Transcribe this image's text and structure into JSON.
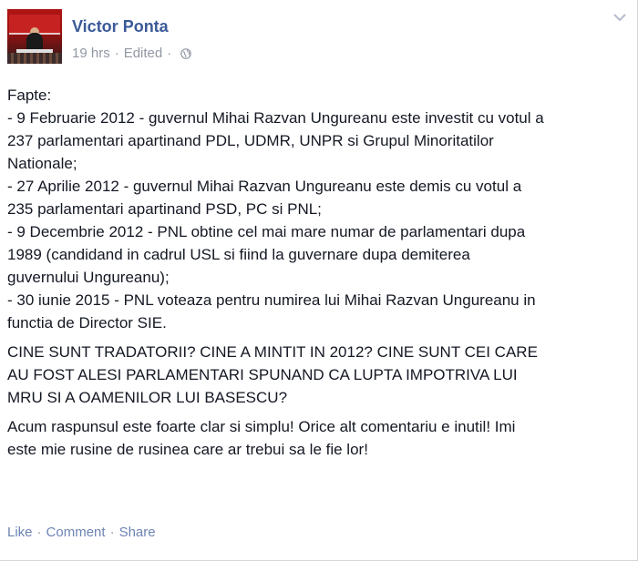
{
  "post": {
    "author": "Victor Ponta",
    "time": "19 hrs",
    "edited": "Edited",
    "separator": "·",
    "paragraph1": [
      "Fapte:",
      "- 9 Februarie 2012 - guvernul Mihai Razvan Ungureanu este investit cu votul a",
      "237 parlamentari apartinand PDL, UDMR, UNPR si Grupul Minoritatilor",
      "Nationale;",
      "- 27 Aprilie 2012 - guvernul Mihai Razvan Ungureanu este demis cu votul a",
      "235 parlamentari apartinand PSD, PC si PNL;",
      "- 9 Decembrie 2012 - PNL obtine cel mai mare numar de parlamentari dupa",
      "1989 (candidand in cadrul USL si fiind la guvernare dupa demiterea",
      "guvernului Ungureanu);",
      "- 30 iunie 2015 - PNL voteaza pentru numirea lui Mihai Razvan Ungureanu in",
      "functia de Director SIE."
    ],
    "paragraph2": [
      "CINE SUNT TRADATORII? CINE A MINTIT IN 2012? CINE SUNT CEI CARE",
      "AU FOST ALESI PARLAMENTARI SPUNAND CA LUPTA IMPOTRIVA LUI",
      "MRU SI A OAMENILOR LUI BASESCU?"
    ],
    "paragraph3": [
      "Acum raspunsul este foarte clar si simplu! Orice alt comentariu e inutil! Imi",
      "este mie rusine de rusinea care ar trebui sa le fie lor!"
    ]
  },
  "actions": {
    "like": "Like",
    "comment": "Comment",
    "share": "Share",
    "separator": "·"
  },
  "colors": {
    "name": "#3b5998",
    "meta": "#9197a3",
    "link": "#6d84b4",
    "text": "#141823"
  },
  "icons": {
    "privacy": "globe-icon",
    "menu": "chevron-down-icon"
  }
}
